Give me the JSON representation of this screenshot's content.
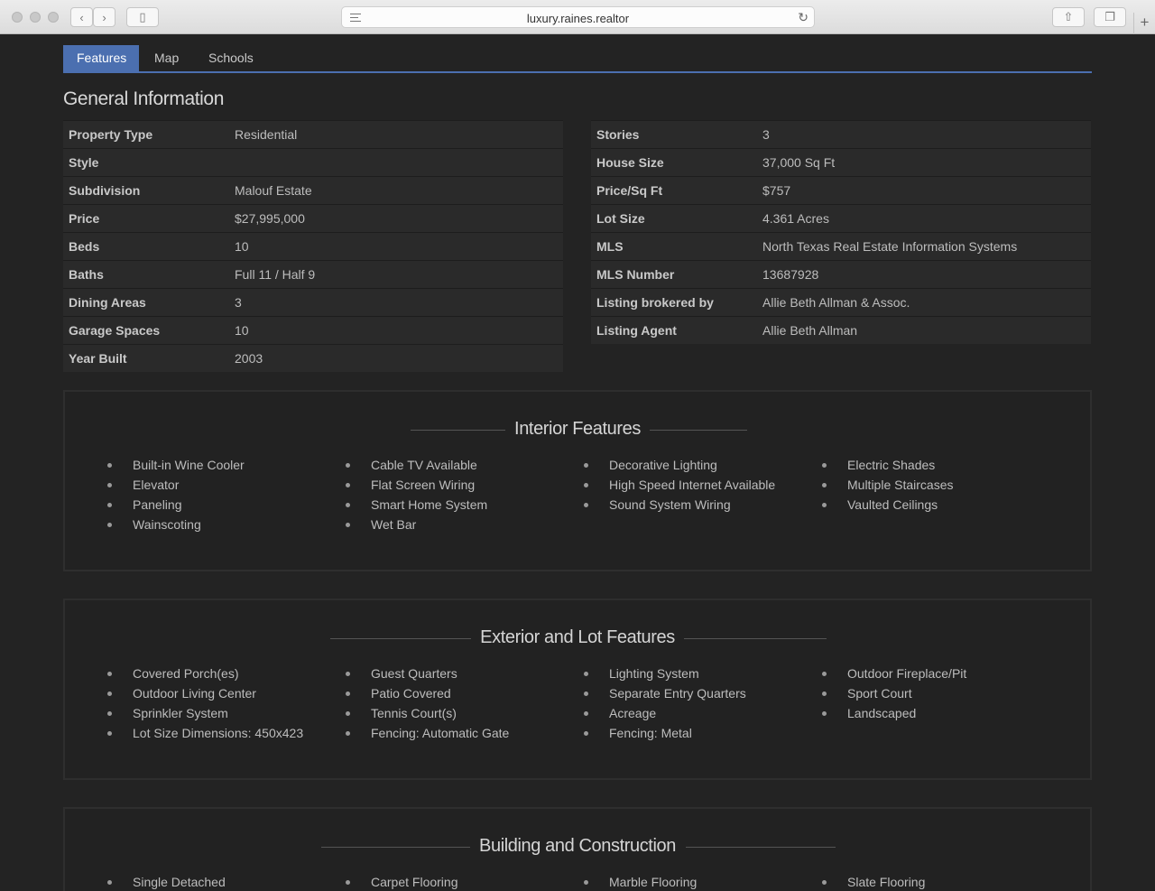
{
  "browser": {
    "url": "luxury.raines.realtor"
  },
  "tabs": [
    "Features",
    "Map",
    "Schools"
  ],
  "general": {
    "title": "General Information",
    "left": [
      {
        "k": "Property Type",
        "v": "Residential"
      },
      {
        "k": "Style",
        "v": ""
      },
      {
        "k": "Subdivision",
        "v": "Malouf Estate"
      },
      {
        "k": "Price",
        "v": "$27,995,000"
      },
      {
        "k": "Beds",
        "v": "10"
      },
      {
        "k": "Baths",
        "v": "Full 11 / Half 9"
      },
      {
        "k": "Dining Areas",
        "v": "3"
      },
      {
        "k": "Garage Spaces",
        "v": "10"
      },
      {
        "k": "Year Built",
        "v": "2003"
      }
    ],
    "right": [
      {
        "k": "Stories",
        "v": "3"
      },
      {
        "k": "House Size",
        "v": "37,000 Sq Ft"
      },
      {
        "k": "Price/Sq Ft",
        "v": "$757"
      },
      {
        "k": "Lot Size",
        "v": "4.361 Acres"
      },
      {
        "k": "MLS",
        "v": "North Texas Real Estate Information Systems"
      },
      {
        "k": "MLS Number",
        "v": "13687928"
      },
      {
        "k": "Listing brokered by",
        "v": "Allie Beth Allman & Assoc."
      },
      {
        "k": "Listing Agent",
        "v": "Allie Beth Allman"
      }
    ]
  },
  "interior": {
    "title": "Interior Features",
    "cols": [
      [
        "Built-in Wine Cooler",
        "Elevator",
        "Paneling",
        "Wainscoting"
      ],
      [
        "Cable TV Available",
        "Flat Screen Wiring",
        "Smart Home System",
        "Wet Bar"
      ],
      [
        "Decorative Lighting",
        "High Speed Internet Available",
        "Sound System Wiring"
      ],
      [
        "Electric Shades",
        "Multiple Staircases",
        "Vaulted Ceilings"
      ]
    ]
  },
  "exterior": {
    "title": "Exterior and Lot Features",
    "cols": [
      [
        "Covered Porch(es)",
        "Outdoor Living Center",
        "Sprinkler System",
        "Lot Size Dimensions: 450x423"
      ],
      [
        "Guest Quarters",
        "Patio Covered",
        "Tennis Court(s)",
        "Fencing: Automatic Gate"
      ],
      [
        "Lighting System",
        "Separate Entry Quarters",
        "Acreage",
        "Fencing: Metal"
      ],
      [
        "Outdoor Fireplace/Pit",
        "Sport Court",
        "Landscaped"
      ]
    ]
  },
  "building": {
    "title": "Building and Construction",
    "cols": [
      [
        "Single Detached"
      ],
      [
        "Carpet Flooring"
      ],
      [
        "Marble Flooring"
      ],
      [
        "Slate Flooring"
      ]
    ]
  }
}
